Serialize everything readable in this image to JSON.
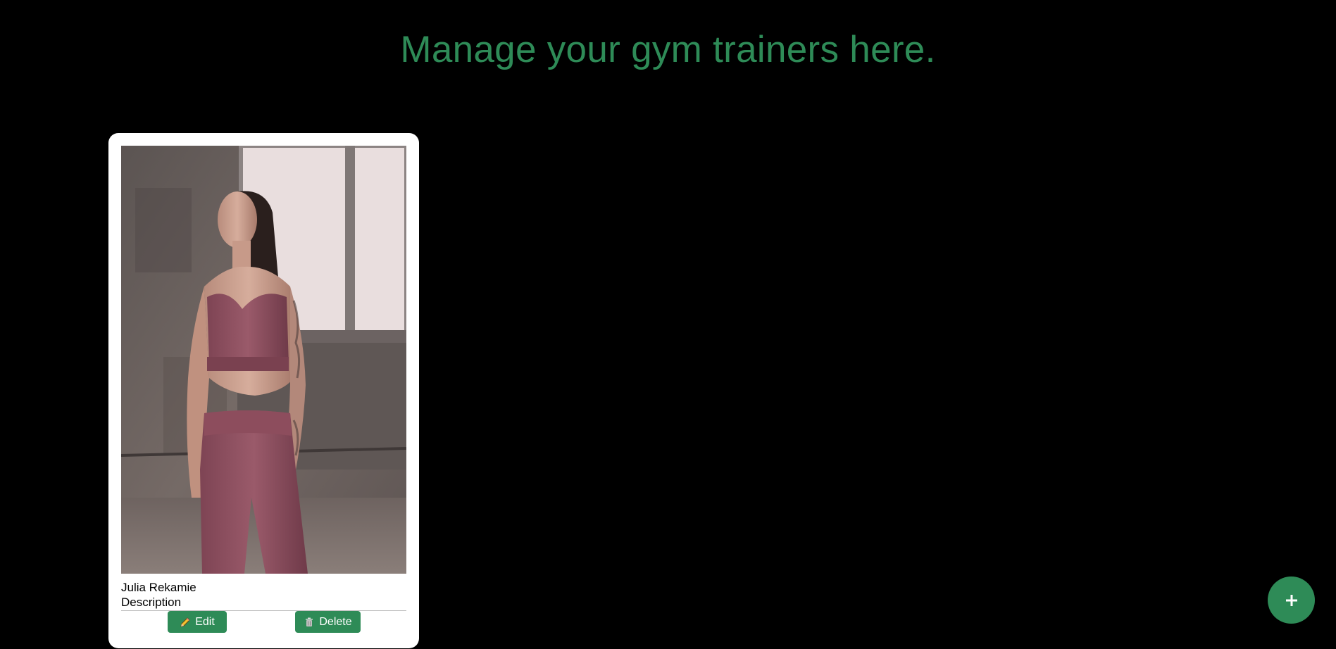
{
  "header": {
    "title": "Manage your gym trainers here."
  },
  "trainers": [
    {
      "name": "Julia Rekamie",
      "description": "Description",
      "photo_icon": "trainer-photo",
      "edit_label": "Edit",
      "edit_icon": "pencil-icon",
      "delete_label": "Delete",
      "delete_icon": "trash-icon"
    }
  ],
  "fab": {
    "label": "+",
    "icon": "plus-icon"
  },
  "colors": {
    "accent": "#2e8b57",
    "background": "#000000",
    "card": "#ffffff"
  }
}
